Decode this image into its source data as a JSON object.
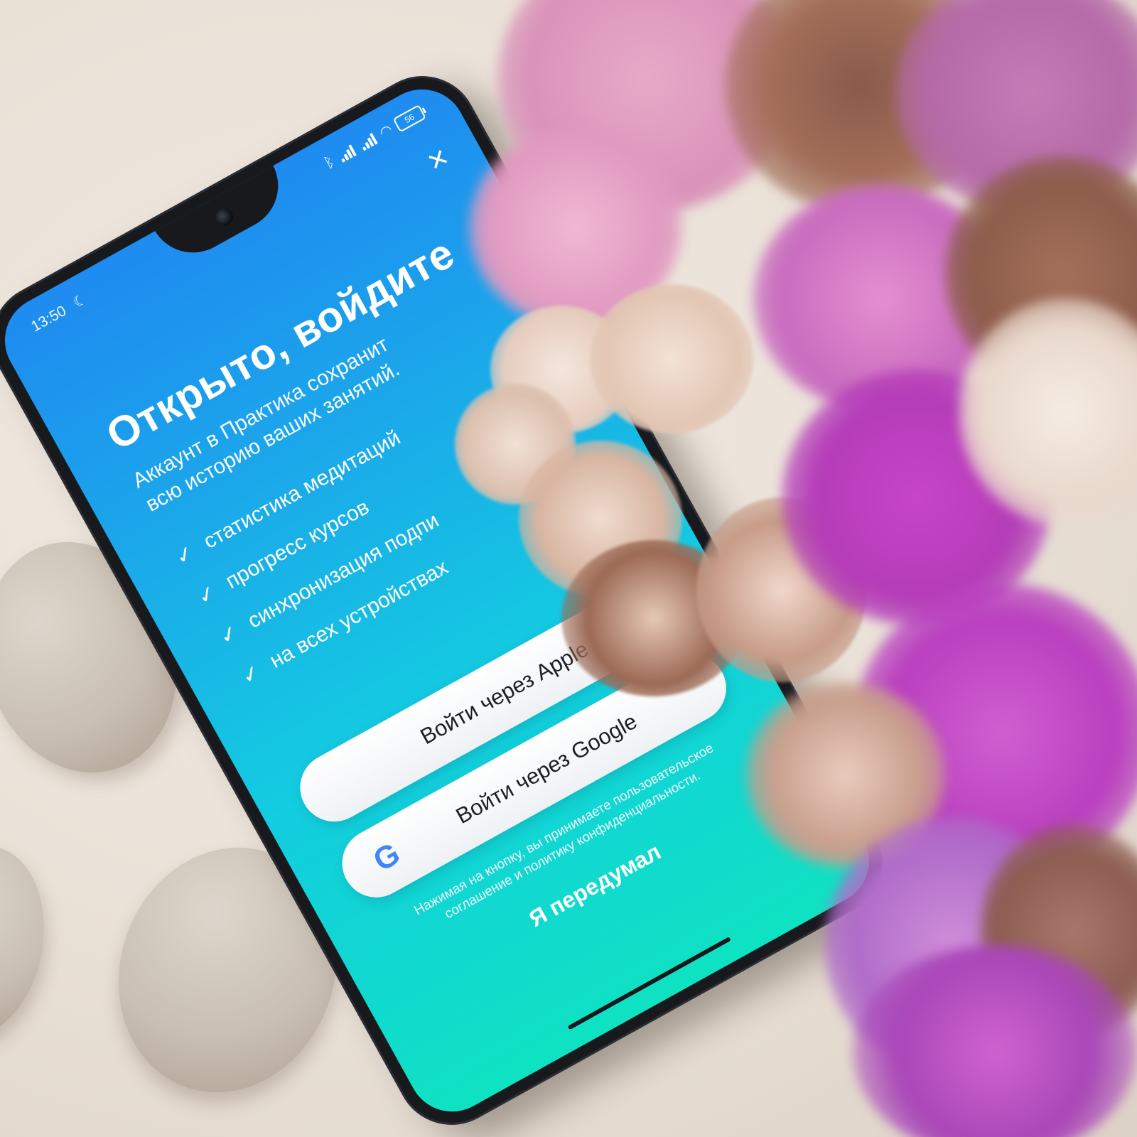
{
  "status_bar": {
    "time": "13:50",
    "battery": "56"
  },
  "screen": {
    "title": "Открыто, войдите",
    "subtitle": "Аккаунт в Практика сохранит всю историю ваших занятий.",
    "features": [
      "статистика медитаций",
      "прогресс курсов",
      "синхронизация подпи",
      "на всех устройствах"
    ],
    "apple_button": "Войти через Apple",
    "google_button": "Войти через Google",
    "legal_text": "Нажимая на кнопку, вы принимаете пользовательское соглашение и политику конфиденциальности.",
    "cancel_label": "Я передумал"
  },
  "icons": {
    "close": "close-icon",
    "check": "check-icon",
    "apple": "apple-icon",
    "google": "google-icon",
    "moon": "moon-icon",
    "bluetooth": "bluetooth-icon",
    "wifi": "wifi-icon"
  },
  "colors": {
    "gradient_top": "#1e8bf0",
    "gradient_bottom": "#0fe2c2",
    "button_bg": "#ffffff",
    "google_blue": "#4285F4"
  }
}
